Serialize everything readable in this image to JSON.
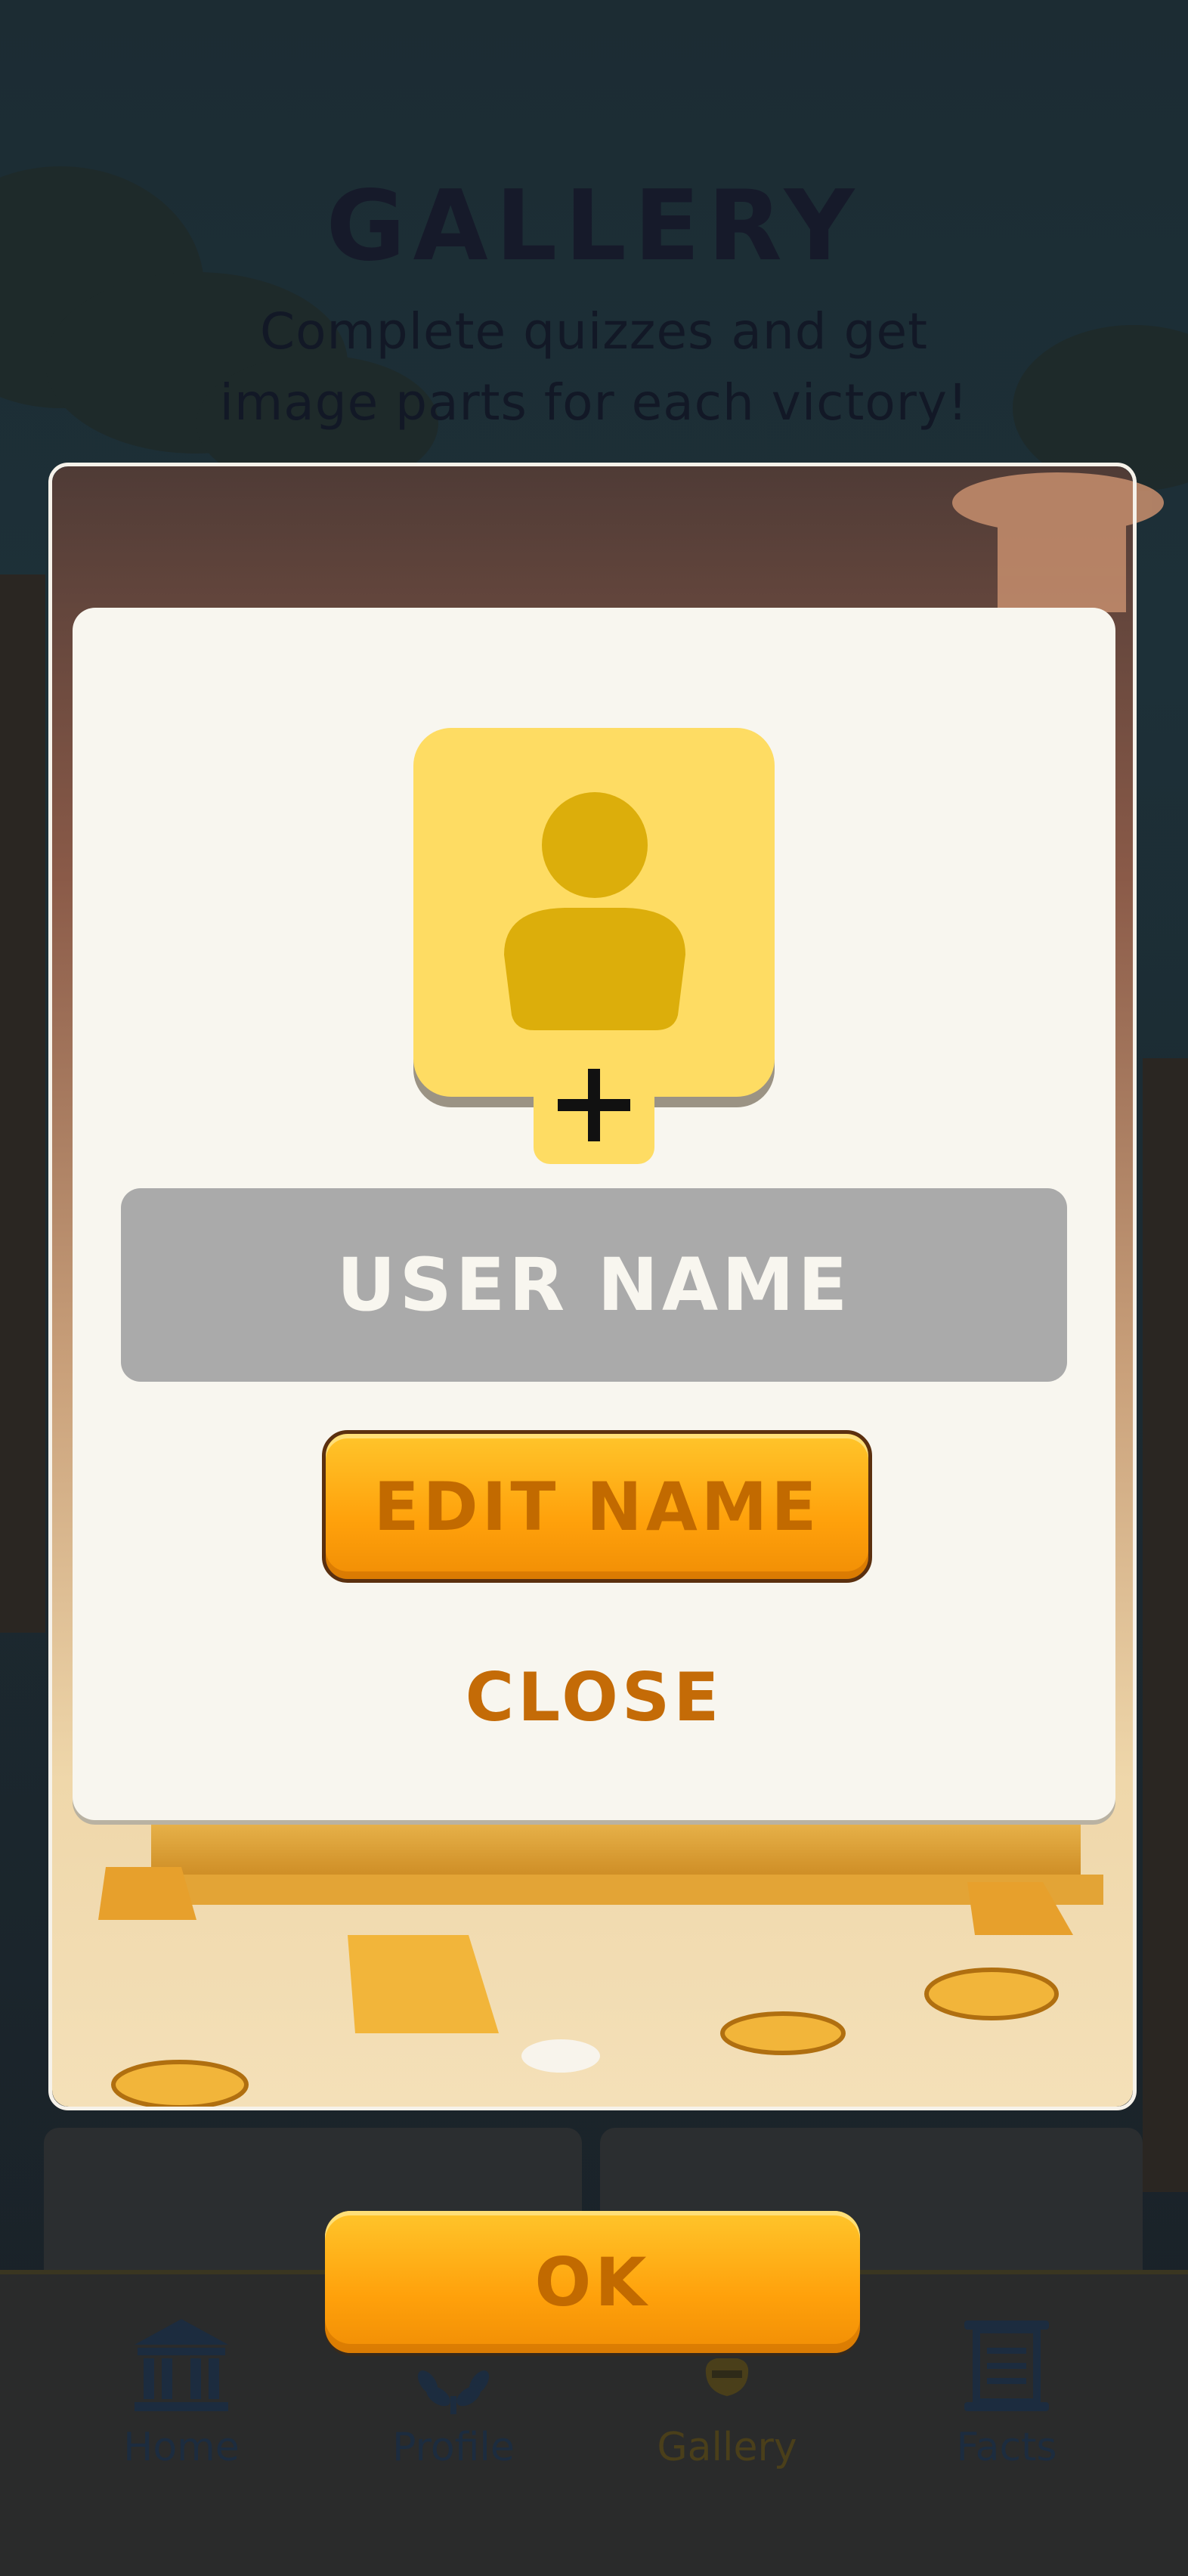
{
  "header": {
    "title": "GALLERY",
    "subtitle": "Complete quizzes and get image parts for each victory!"
  },
  "profile_modal": {
    "user_name_placeholder": "USER NAME",
    "edit_button": "EDIT NAME",
    "close_button": "CLOSE",
    "avatar_icon": "person-icon",
    "add_icon": "plus-icon"
  },
  "ok_button": "OK",
  "nav": {
    "items": [
      {
        "label": "Home",
        "icon": "temple-icon"
      },
      {
        "label": "Profile",
        "icon": "laurel-icon"
      },
      {
        "label": "Gallery",
        "icon": "vase-icon",
        "active": true
      },
      {
        "label": "Facts",
        "icon": "scroll-icon"
      }
    ]
  },
  "colors": {
    "accent_orange": "#ffa10b",
    "button_text": "#c26a00",
    "avatar_yellow": "#fedc63",
    "avatar_figure": "#dcae0b",
    "nav_text": "#1c2c3f",
    "nav_active_text": "#4a3f1a"
  }
}
